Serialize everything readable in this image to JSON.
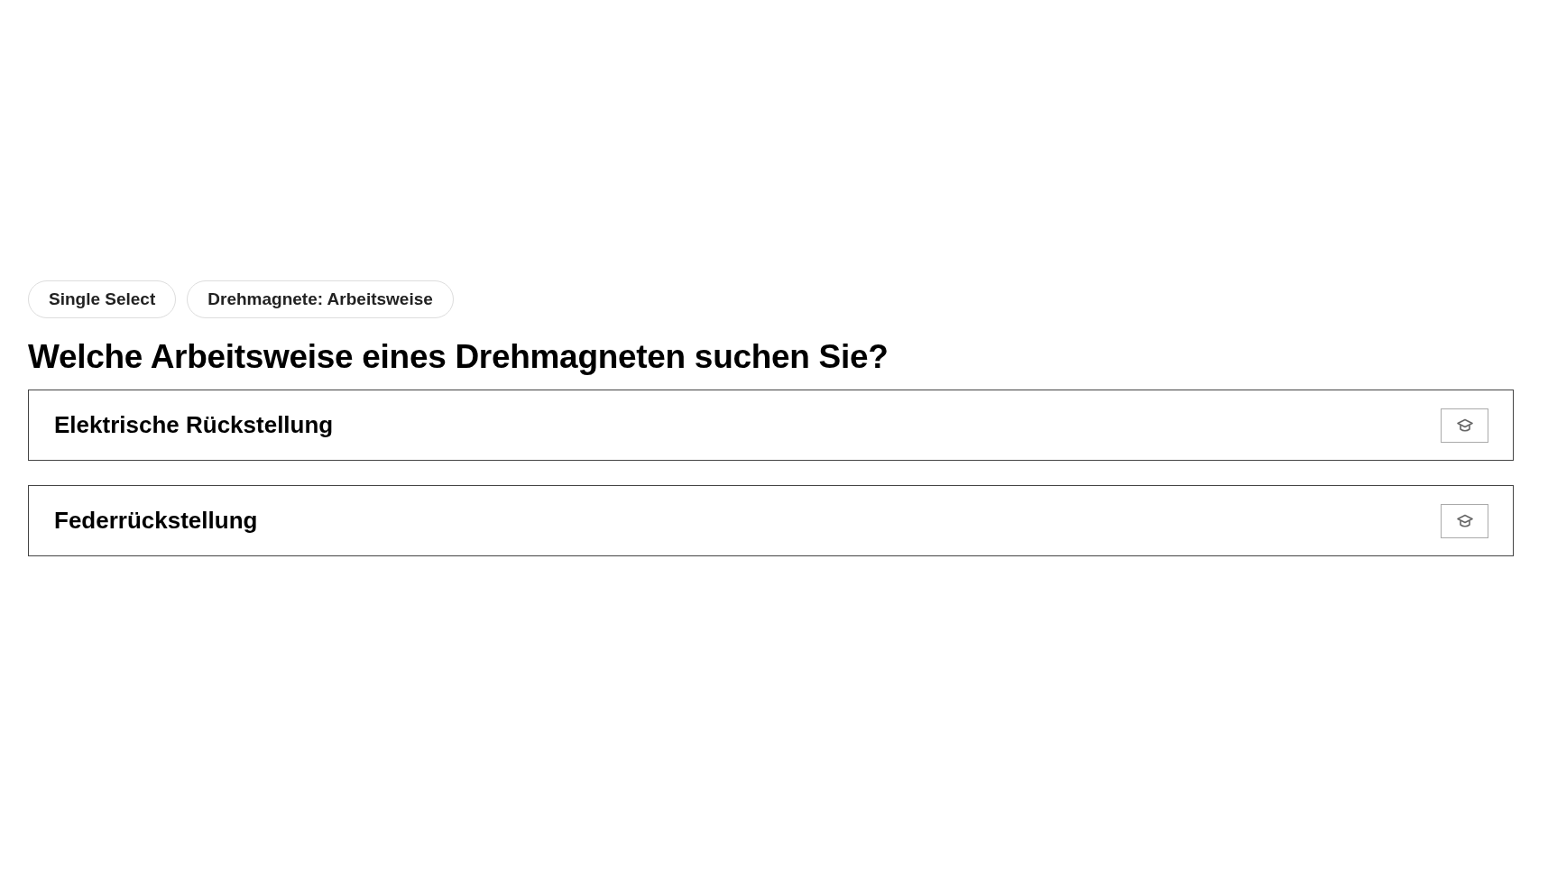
{
  "tags": [
    "Single Select",
    "Drehmagnete: Arbeitsweise"
  ],
  "question": "Welche Arbeitsweise eines Drehmagneten suchen Sie?",
  "options": [
    {
      "label": "Elektrische Rückstellung",
      "selected": false
    },
    {
      "label": "Federrückstellung",
      "selected": false
    }
  ]
}
